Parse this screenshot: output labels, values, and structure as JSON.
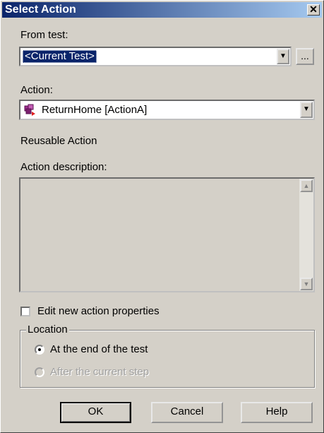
{
  "window": {
    "title": "Select Action",
    "close_symbol": "✕"
  },
  "from_test": {
    "label": "From test:",
    "value": "<Current Test>",
    "browse_label": "..."
  },
  "action": {
    "label": "Action:",
    "value": "ReturnHome [ActionA]",
    "icon": "action-icon"
  },
  "reusable_text": "Reusable Action",
  "description": {
    "label": "Action description:",
    "value": ""
  },
  "edit_props": {
    "label": "Edit new action properties",
    "checked": false
  },
  "location": {
    "legend": "Location",
    "options": [
      {
        "label": "At the end of the test",
        "selected": true,
        "enabled": true
      },
      {
        "label": "After the current step",
        "selected": false,
        "enabled": false
      }
    ]
  },
  "buttons": {
    "ok": "OK",
    "cancel": "Cancel",
    "help": "Help"
  },
  "colors": {
    "face": "#d4d0c8",
    "title_bar": "#0a246a",
    "selection": "#0a246a",
    "disabled_text": "#a0a0a0"
  }
}
